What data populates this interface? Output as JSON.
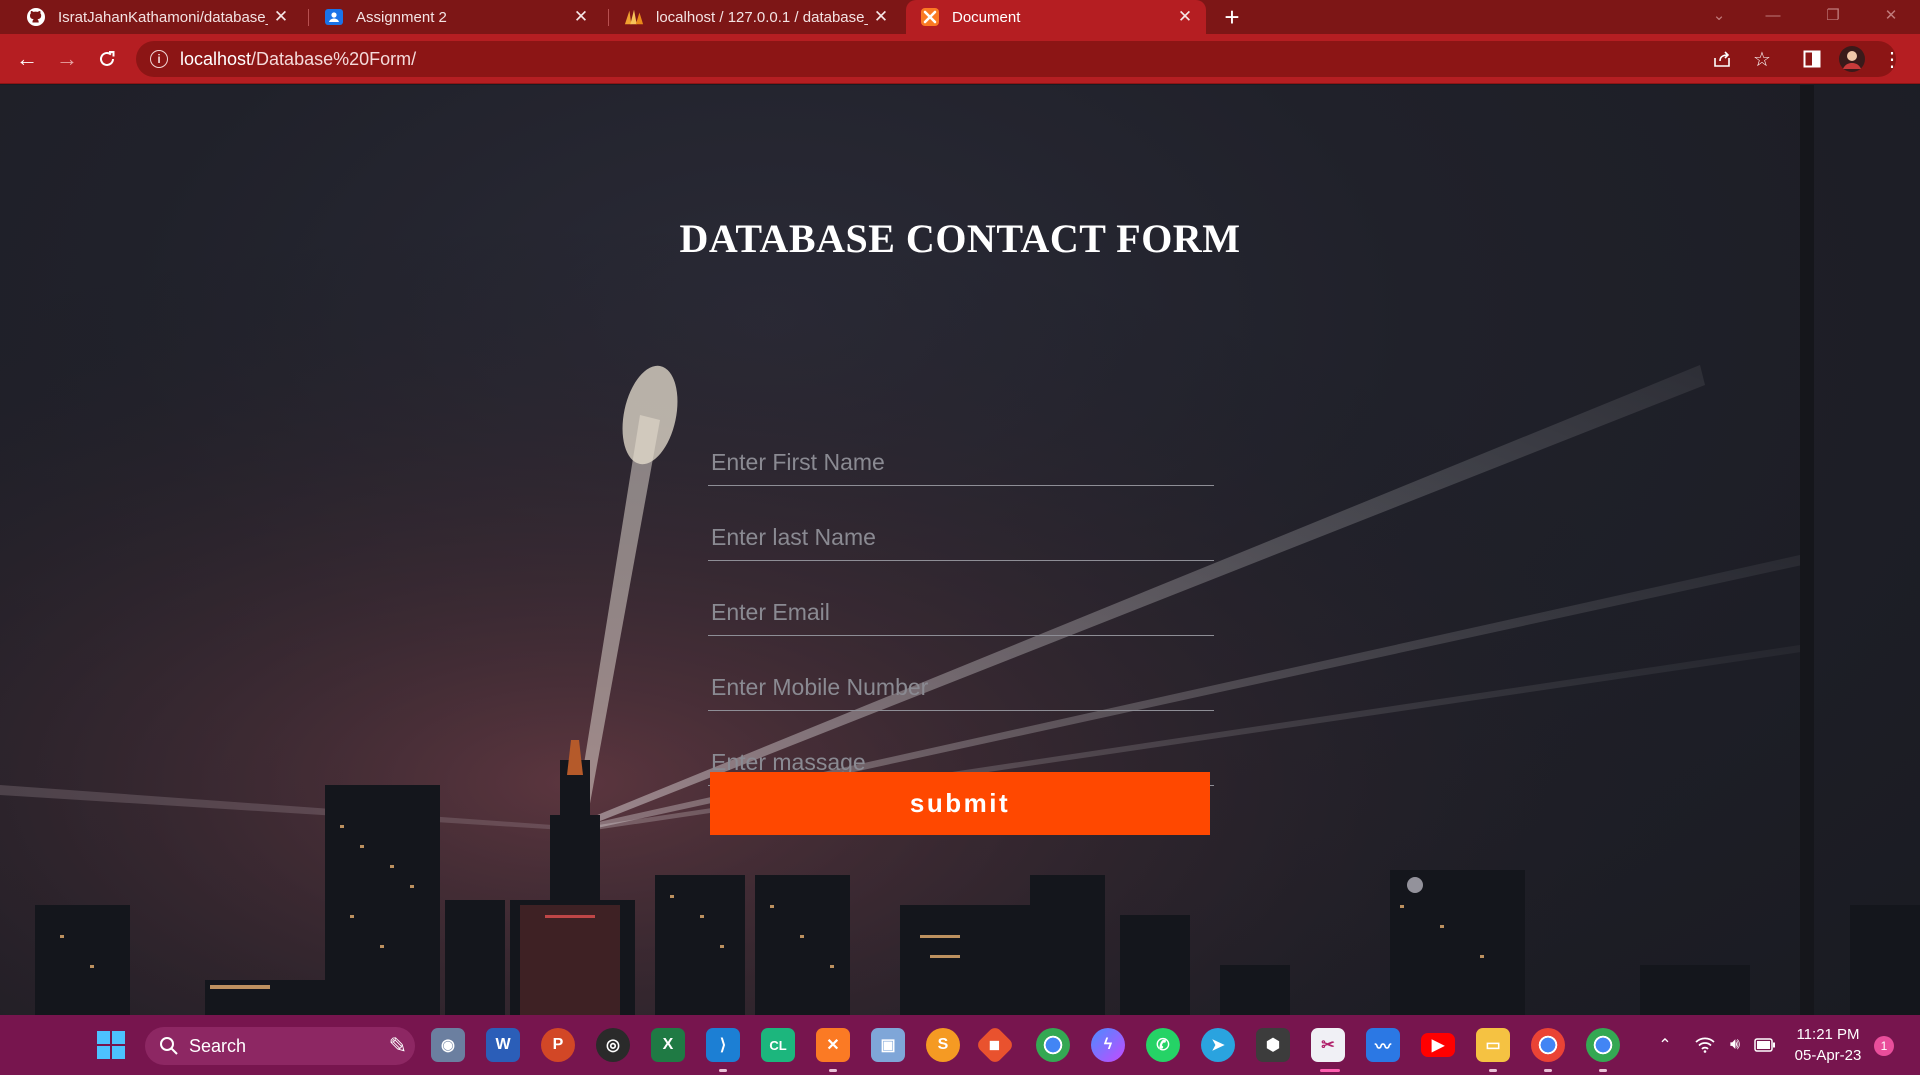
{
  "browser": {
    "tabs": [
      {
        "title": "IsratJahanKathamoni/database_c",
        "icon": "github-icon"
      },
      {
        "title": "Assignment 2",
        "icon": "classroom-icon"
      },
      {
        "title": "localhost / 127.0.0.1 / database_c",
        "icon": "phpmyadmin-icon"
      },
      {
        "title": "Document",
        "icon": "xampp-icon",
        "active": true
      }
    ],
    "url_host": "localhost",
    "url_path": "/Database%20Form/"
  },
  "page": {
    "title": "DATABASE CONTACT FORM",
    "fields": {
      "first_name": "Enter First Name",
      "last_name": "Enter last Name",
      "email": "Enter Email",
      "mobile": "Enter Mobile Number",
      "message": "Enter massage"
    },
    "submit_label": "submit",
    "accent_color": "#ff4800"
  },
  "taskbar": {
    "search_label": "Search",
    "time": "11:21 PM",
    "date": "05-Apr-23",
    "notification_count": "1",
    "color": "#77154e"
  }
}
